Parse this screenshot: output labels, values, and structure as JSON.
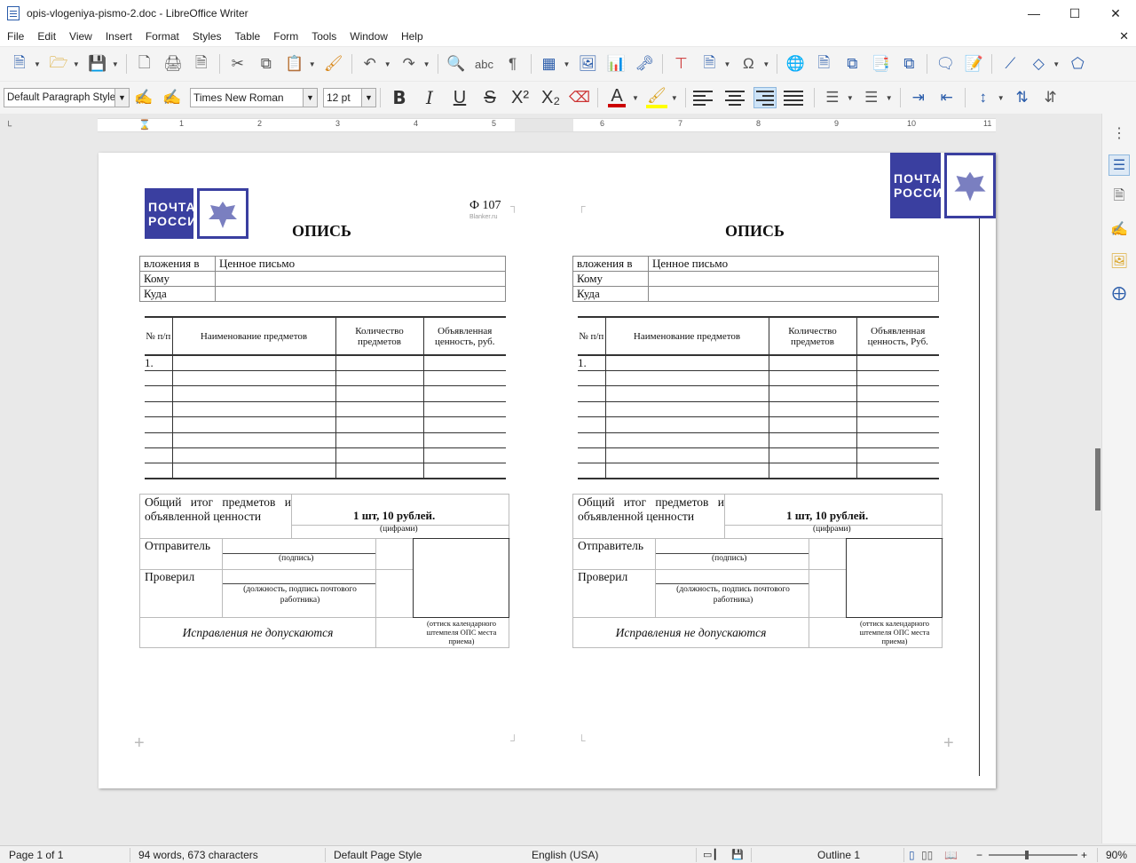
{
  "window": {
    "title": "opis-vlogeniya-pismo-2.doc - LibreOffice Writer"
  },
  "menu": [
    "File",
    "Edit",
    "View",
    "Insert",
    "Format",
    "Styles",
    "Table",
    "Form",
    "Tools",
    "Window",
    "Help"
  ],
  "toolbar2": {
    "paragraph_style": "Default Paragraph Style",
    "font_name": "Times New Roman",
    "font_size": "12 pt"
  },
  "ruler": {
    "numbers": [
      "1",
      "2",
      "3",
      "4",
      "5",
      "6",
      "7",
      "8",
      "9",
      "10",
      "11"
    ]
  },
  "document": {
    "logo_top": "ПОЧТА",
    "logo_bottom": "РОССИИ",
    "form_code": "Ф 107",
    "watermark": "Blanker.ru",
    "title": "ОПИСЬ",
    "rows": [
      {
        "label": "вложения в",
        "value": "Ценное письмо"
      },
      {
        "label": "Кому",
        "value": ""
      },
      {
        "label": "Куда",
        "value": ""
      }
    ],
    "col_num": "№ п/п",
    "col_name": "Наименование предметов",
    "col_qty": "Количество предметов",
    "col_val_left": "Объявленная ценность, руб.",
    "col_val_right": "Объявленная ценность, Руб.",
    "first_item": "1.",
    "total_label": "Общий итог предметов и объявленной ценности",
    "total_value": "1 шт, 10 рублей.",
    "digits_note": "(цифрами)",
    "sender": "Отправитель",
    "signature_note": "(подпись)",
    "checked": "Проверил",
    "position_note": "(должность, подпись почтового работника)",
    "no_corrections": "Исправления не допускаются",
    "stamp_note": "(оттиск календарного штемпеля ОПС места приема)"
  },
  "status": {
    "page": "Page 1 of 1",
    "words": "94 words, 673 characters",
    "page_style": "Default Page Style",
    "language": "English (USA)",
    "outline": "Outline 1",
    "zoom": "90%"
  }
}
